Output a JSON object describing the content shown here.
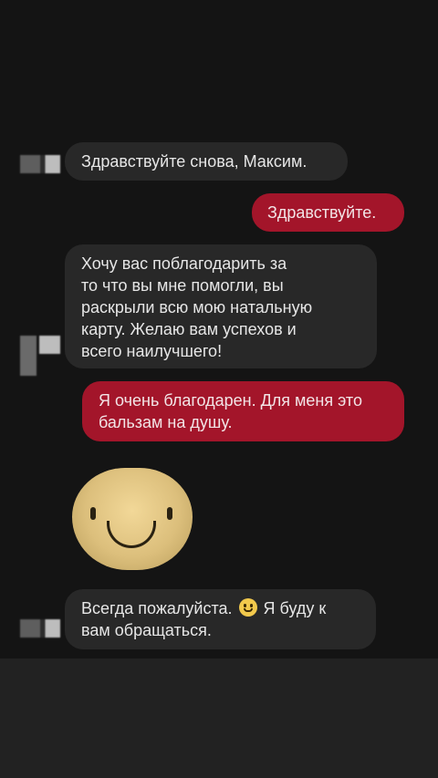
{
  "messages": {
    "m1": {
      "text": "Здравствуйте снова, Максим."
    },
    "m2": {
      "text": "Здравствуйте."
    },
    "m3": {
      "line1": "Хочу вас поблагодарить за",
      "line2": "то что вы мне помогли, вы",
      "line3": "раскрыли всю мою натальную",
      "line4": "карту. Желаю вам успехов и",
      "line5": "всего наилучшего!"
    },
    "m4": {
      "line1": "Я очень благодарен. Для меня это",
      "line2": "бальзам на душу."
    },
    "m5": {
      "line1_a": "Всегда пожалуйста.",
      "emoji": "slightly-smiling-face-icon",
      "line1_b": "Я буду к",
      "line2": "вам обращаться."
    }
  },
  "colors": {
    "background": "#141414",
    "incoming": "#282828",
    "outgoing": "#a3152a",
    "footer": "#222222"
  }
}
